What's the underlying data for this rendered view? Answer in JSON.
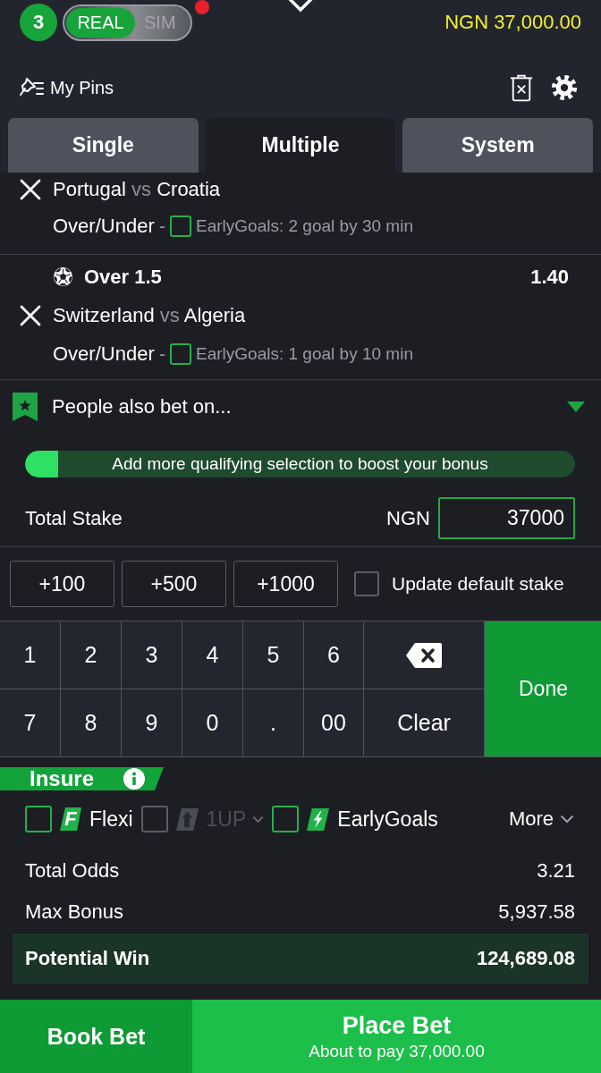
{
  "header": {
    "bet_count": "3",
    "mode_toggle": [
      {
        "label": "REAL",
        "selected": true
      },
      {
        "label": "SIM",
        "selected": false
      }
    ],
    "has_notification": true,
    "balance": "NGN 37,000.00"
  },
  "toolbar": {
    "pins_label": "My Pins"
  },
  "tabs": [
    {
      "label": "Single",
      "selected": false
    },
    {
      "label": "Multiple",
      "selected": true
    },
    {
      "label": "System",
      "selected": false
    }
  ],
  "selections": [
    {
      "home": "Portugal",
      "vs": "vs",
      "away": "Croatia",
      "market": "Over/Under",
      "dash": "-",
      "addon": {
        "label": "EarlyGoals: 2 goal by 30 min",
        "checked": false
      }
    },
    {
      "pick": "Over 1.5",
      "odds": "1.40",
      "home": "Switzerland",
      "vs": "vs",
      "away": "Algeria",
      "market": "Over/Under",
      "dash": "-",
      "addon": {
        "label": "EarlyGoals: 1 goal by 10 min",
        "checked": false
      }
    }
  ],
  "also_bet": {
    "label": "People also bet on...",
    "expanded": false
  },
  "bonus_progress": {
    "label": "Add more qualifying selection to boost your bonus",
    "level": 0.06
  },
  "stake": {
    "label": "Total Stake",
    "currency": "NGN",
    "value": "37000"
  },
  "quick_stakes": [
    "+100",
    "+500",
    "+1000"
  ],
  "default_stake": {
    "label": "Update default stake",
    "checked": false
  },
  "keypad": [
    {
      "kind": "char",
      "label": "1"
    },
    {
      "kind": "char",
      "label": "2"
    },
    {
      "kind": "char",
      "label": "3"
    },
    {
      "kind": "char",
      "label": "4"
    },
    {
      "kind": "char",
      "label": "5"
    },
    {
      "kind": "char",
      "label": "6"
    },
    {
      "kind": "backspace"
    },
    {
      "kind": "done",
      "label": "Done"
    },
    {
      "kind": "char",
      "label": "7"
    },
    {
      "kind": "char",
      "label": "8"
    },
    {
      "kind": "char",
      "label": "9"
    },
    {
      "kind": "char",
      "label": "0"
    },
    {
      "kind": "char",
      "label": "."
    },
    {
      "kind": "char",
      "label": "00"
    },
    {
      "kind": "clear",
      "label": "Clear"
    }
  ],
  "insurance": {
    "label": "Insure",
    "options": [
      {
        "kind": "flexi",
        "icon_text": "F",
        "label": "Flexi",
        "checked": false,
        "disabled": false
      },
      {
        "kind": "one_up",
        "label": "1UP",
        "checked": false,
        "disabled": true
      },
      {
        "kind": "early_goals",
        "label": "EarlyGoals",
        "checked": false,
        "disabled": false
      }
    ],
    "more": "More"
  },
  "summary": [
    {
      "label": "Total Odds",
      "value": "3.21"
    },
    {
      "label": "Max Bonus",
      "value": "5,937.58"
    }
  ],
  "potential_win": {
    "label": "Potential Win",
    "value": "124,689.08"
  },
  "actions": {
    "book": "Book Bet",
    "place": "Place Bet",
    "place_subtitle": "About to pay 37,000.00"
  }
}
